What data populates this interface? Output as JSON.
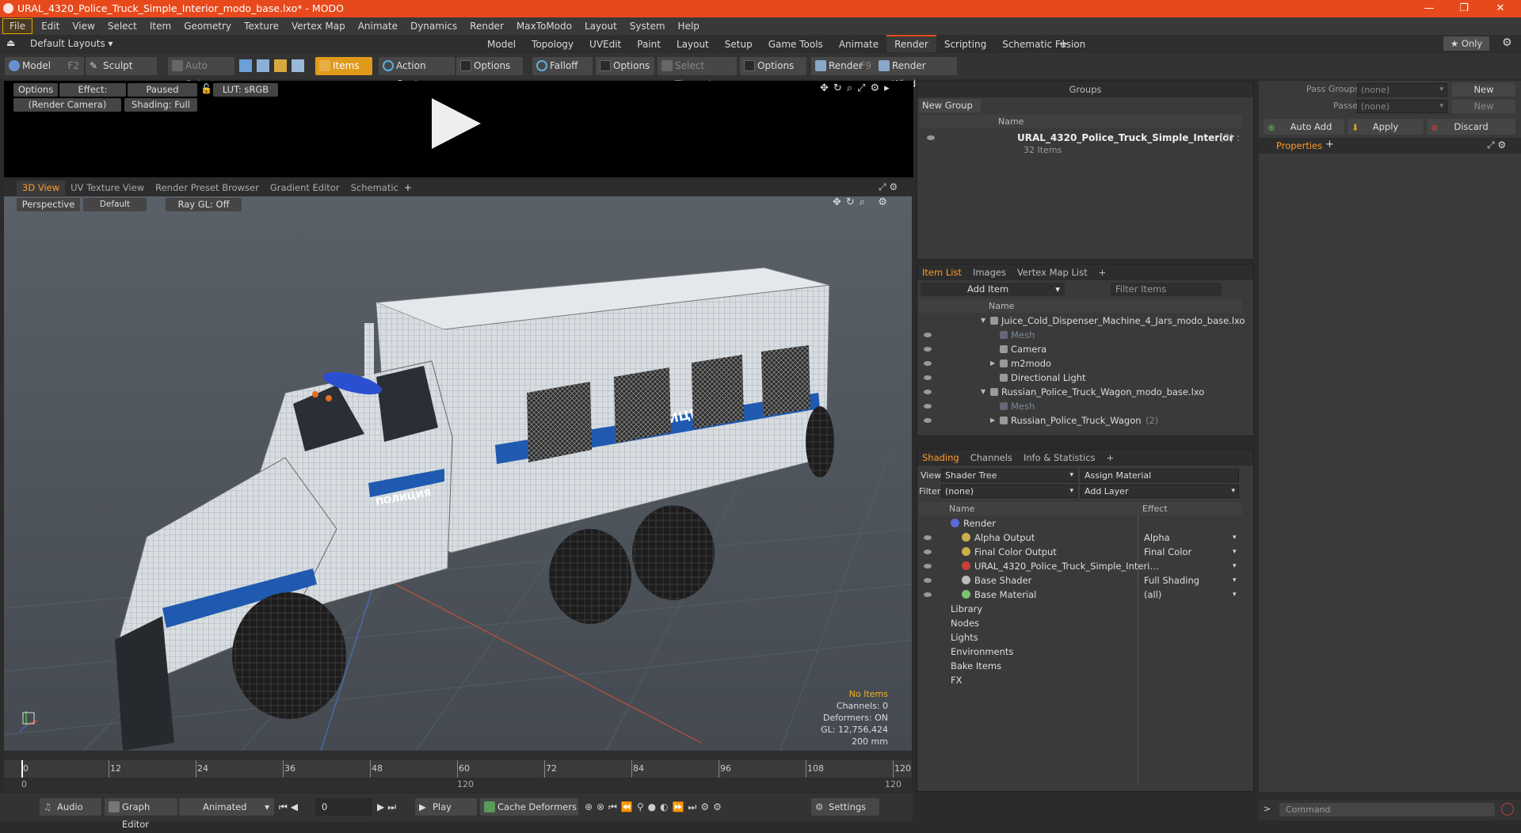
{
  "window": {
    "title": "URAL_4320_Police_Truck_Simple_Interior_modo_base.lxo* - MODO",
    "minimize": "—",
    "maximize": "❐",
    "close": "✕"
  },
  "menu": [
    "File",
    "Edit",
    "View",
    "Select",
    "Item",
    "Geometry",
    "Texture",
    "Vertex Map",
    "Animate",
    "Dynamics",
    "Render",
    "MaxToModo",
    "Layout",
    "System",
    "Help"
  ],
  "layout_selector": "Default Layouts",
  "workspace_tabs": [
    "Model",
    "Topology",
    "UVEdit",
    "Paint",
    "Layout",
    "Setup",
    "Game Tools",
    "Animate",
    "Render",
    "Scripting",
    "Schematic Fusion"
  ],
  "workspace_active": "Render",
  "only_label": "Only",
  "toolbar": {
    "model": "Model",
    "model_key": "F2",
    "sculpt": "Sculpt",
    "auto_select": "Auto Select",
    "items": "Items",
    "action_center": "Action Center",
    "options1": "Options",
    "falloff": "Falloff",
    "options2": "Options",
    "select_through": "Select Through",
    "options3": "Options",
    "render": "Render",
    "render_key": "F9",
    "render_window": "Render Window"
  },
  "preview": {
    "options": "Options",
    "effect": "Effect: (Shadi…",
    "paused": "Paused",
    "lut": "LUT: sRGB",
    "camera": "(Render Camera)",
    "shading": "Shading: Full"
  },
  "view_tabs": [
    "3D View",
    "UV Texture View",
    "Render Preset Browser",
    "Gradient Editor",
    "Schematic"
  ],
  "viewport": {
    "perspective": "Perspective",
    "default": "Default",
    "raygl": "Ray GL: Off",
    "decal_side": "ПОЛИЦИЯ",
    "decal_door": "ПОЛИЦИЯ",
    "stats": {
      "no_items": "No Items",
      "channels": "Channels: 0",
      "deformers": "Deformers: ON",
      "gl": "GL: 12,756,424",
      "scale": "200 mm"
    }
  },
  "timeline": {
    "ticks": [
      "0",
      "12",
      "24",
      "36",
      "48",
      "60",
      "72",
      "84",
      "96",
      "108",
      "120"
    ],
    "lower": [
      "0",
      "120",
      "120"
    ]
  },
  "bottom": {
    "audio": "Audio",
    "graph_editor": "Graph Editor",
    "animated": "Animated",
    "frame": "0",
    "play": "Play",
    "cache": "Cache Deformers",
    "settings": "Settings"
  },
  "groups": {
    "title": "Groups",
    "new_group": "New Group",
    "col_name": "Name",
    "item_name": "URAL_4320_Police_Truck_Simple_Interior",
    "item_count": "(3) :",
    "item_sub": "32 Items"
  },
  "item_list": {
    "tabs": [
      "Item List",
      "Images",
      "Vertex Map List"
    ],
    "add_item": "Add Item",
    "filter": "Filter Items",
    "col_name": "Name",
    "rows": [
      {
        "label": "Juice_Cold_Dispenser_Machine_4_Jars_modo_base.lxo",
        "indent": 0,
        "dim": false,
        "arrow": "▼"
      },
      {
        "label": "Mesh",
        "indent": 1,
        "dim": true,
        "arrow": ""
      },
      {
        "label": "Camera",
        "indent": 1,
        "dim": false,
        "arrow": ""
      },
      {
        "label": "m2modo",
        "indent": 1,
        "dim": false,
        "arrow": "▶"
      },
      {
        "label": "Directional Light",
        "indent": 1,
        "dim": false,
        "arrow": ""
      },
      {
        "label": "Russian_Police_Truck_Wagon_modo_base.lxo",
        "indent": 0,
        "dim": false,
        "arrow": "▼"
      },
      {
        "label": "Mesh",
        "indent": 1,
        "dim": true,
        "arrow": ""
      },
      {
        "label": "Russian_Police_Truck_Wagon",
        "indent": 1,
        "dim": false,
        "arrow": "▶",
        "extra": "(2)"
      }
    ]
  },
  "shading": {
    "tabs": [
      "Shading",
      "Channels",
      "Info & Statistics"
    ],
    "view_label": "View",
    "view_value": "Shader Tree",
    "assign": "Assign Material",
    "filter_label": "Filter",
    "filter_value": "(none)",
    "add_layer": "Add Layer",
    "col_name": "Name",
    "col_effect": "Effect",
    "rows": [
      {
        "label": "Render",
        "effect": "",
        "indent": 0,
        "eye": false,
        "color": "#5a6bd8"
      },
      {
        "label": "Alpha Output",
        "effect": "Alpha",
        "indent": 1,
        "eye": true,
        "color": "#c9b04a"
      },
      {
        "label": "Final Color Output",
        "effect": "Final Color",
        "indent": 1,
        "eye": true,
        "color": "#c9b04a"
      },
      {
        "label": "URAL_4320_Police_Truck_Simple_Interi…",
        "effect": "",
        "indent": 1,
        "eye": true,
        "color": "#c9403a"
      },
      {
        "label": "Base Shader",
        "effect": "Full Shading",
        "indent": 1,
        "eye": true,
        "color": "#bbbbbb"
      },
      {
        "label": "Base Material",
        "effect": "(all)",
        "indent": 1,
        "eye": true,
        "color": "#7ac070"
      },
      {
        "label": "Library",
        "effect": "",
        "indent": 0,
        "eye": false,
        "color": ""
      },
      {
        "label": "Nodes",
        "effect": "",
        "indent": 0,
        "eye": false,
        "color": ""
      },
      {
        "label": "Lights",
        "effect": "",
        "indent": 0,
        "eye": false,
        "color": ""
      },
      {
        "label": "Environments",
        "effect": "",
        "indent": 0,
        "eye": false,
        "color": ""
      },
      {
        "label": "Bake Items",
        "effect": "",
        "indent": 0,
        "eye": false,
        "color": ""
      },
      {
        "label": "FX",
        "effect": "",
        "indent": 0,
        "eye": false,
        "color": ""
      }
    ]
  },
  "properties": {
    "pass_groups": "Pass Groups",
    "passes": "Passes",
    "none": "(none)",
    "new": "New",
    "auto_add": "Auto Add",
    "apply": "Apply",
    "discard": "Discard",
    "tab": "Properties",
    "command": "Command"
  }
}
